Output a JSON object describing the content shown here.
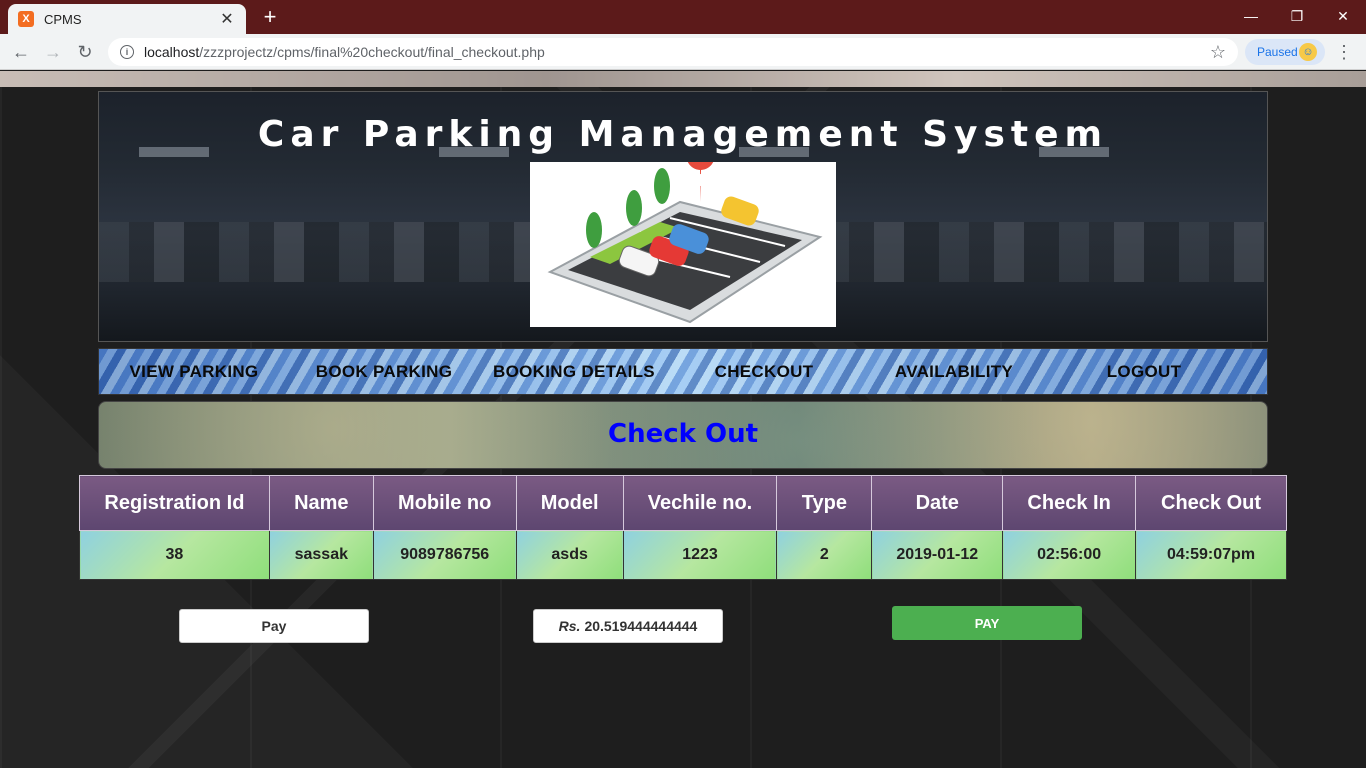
{
  "browser": {
    "tab_title": "CPMS",
    "tab_favicon_text": "X",
    "url_host": "localhost",
    "url_path": "/zzzprojectz/cpms/final%20checkout/final_checkout.php",
    "paused_label": "Paused",
    "icons": {
      "back": "arrow-left",
      "forward": "arrow-right",
      "reload": "reload",
      "info": "info",
      "star": "star",
      "menu": "vertical-dots",
      "close": "close",
      "new_tab": "plus"
    }
  },
  "header": {
    "title": "Car Parking Management System"
  },
  "nav": {
    "items": [
      "VIEW PARKING",
      "BOOK PARKING",
      "BOOKING DETAILS",
      "CHECKOUT",
      "AVAILABILITY",
      "LOGOUT"
    ]
  },
  "section": {
    "title": "Check Out"
  },
  "table": {
    "headers": [
      "Registration Id",
      "Name",
      "Mobile no",
      "Model",
      "Vechile no.",
      "Type",
      "Date",
      "Check In",
      "Check Out"
    ],
    "rows": [
      [
        "38",
        "sassak",
        "9089786756",
        "asds",
        "1223",
        "2",
        "2019-01-12",
        "02:56:00",
        "04:59:07pm"
      ]
    ]
  },
  "payment": {
    "pay_field_value": "Pay",
    "currency": "Rs.",
    "amount": "20.519444444444",
    "pay_button_label": "PAY"
  },
  "colors": {
    "titlebar": "#5c1a1a",
    "check_out_title": "#0000ff",
    "pay_button": "#4caf50",
    "table_header": "#6a4f78"
  }
}
